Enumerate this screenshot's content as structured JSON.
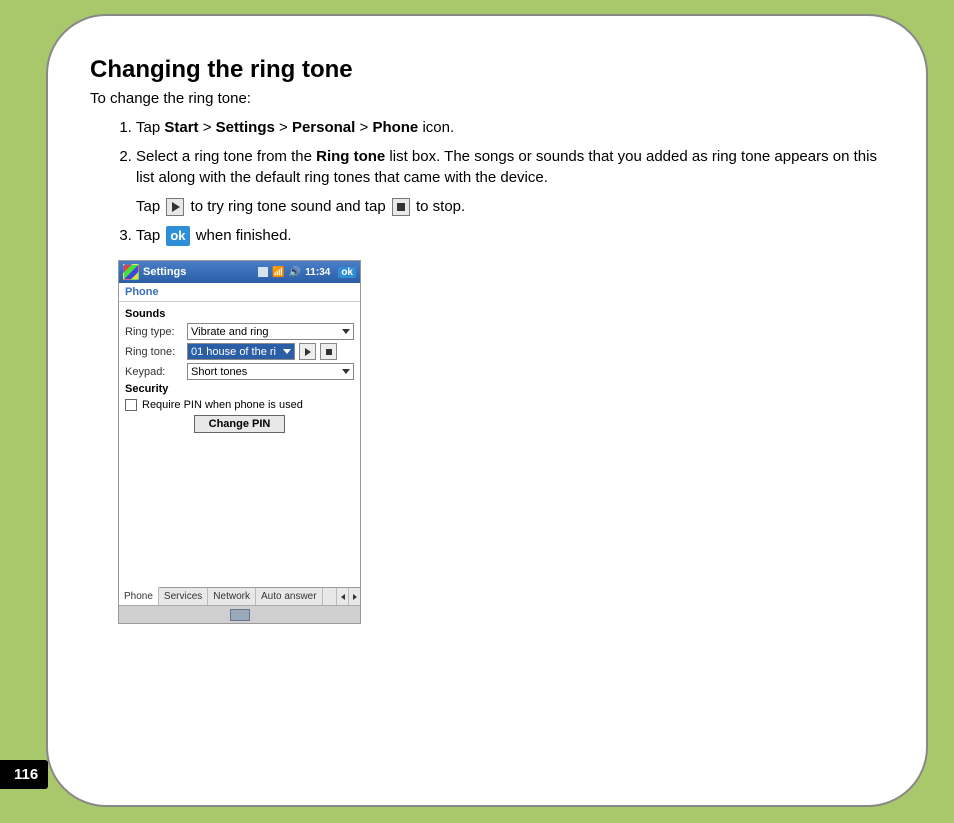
{
  "page_number": "116",
  "title": "Changing the ring tone",
  "intro": "To change the ring tone:",
  "steps": {
    "s1_pre": "Tap ",
    "s1_b1": "Start",
    "s1_sep": " > ",
    "s1_b2": "Settings",
    "s1_b3": "Personal",
    "s1_b4": "Phone",
    "s1_post": " icon.",
    "s2_pre": "Select a ring tone from the ",
    "s2_b1": "Ring tone",
    "s2_post": " list box. The songs or sounds that you added as ring tone appears on this list along with the default ring tones that came with the device.",
    "s2_sub_pre": "Tap ",
    "s2_sub_mid": " to try ring tone sound and tap ",
    "s2_sub_post": " to stop.",
    "s3_pre": "Tap ",
    "s3_ok": "ok",
    "s3_post": " when finished."
  },
  "device": {
    "titlebar": {
      "title": "Settings",
      "time": "11:34",
      "ok": "ok"
    },
    "subheader": "Phone",
    "sounds_label": "Sounds",
    "rows": {
      "ring_type_label": "Ring type:",
      "ring_type_value": "Vibrate and ring",
      "ring_tone_label": "Ring tone:",
      "ring_tone_value": "01 house of the ri",
      "keypad_label": "Keypad:",
      "keypad_value": "Short tones"
    },
    "security_label": "Security",
    "require_pin": "Require PIN when phone is used",
    "change_pin": "Change PIN",
    "tabs": [
      "Phone",
      "Services",
      "Network",
      "Auto answer"
    ]
  }
}
